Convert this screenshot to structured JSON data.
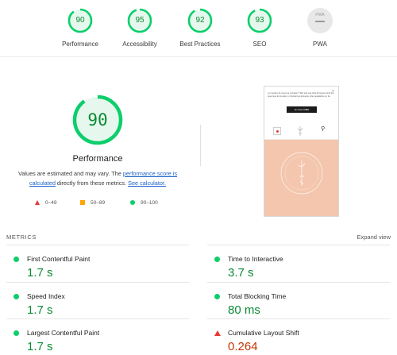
{
  "categories": [
    {
      "label": "Performance",
      "score": "90",
      "fraction": 0.9,
      "color": "#0cce6b"
    },
    {
      "label": "Accessibility",
      "score": "95",
      "fraction": 0.95,
      "color": "#0cce6b"
    },
    {
      "label": "Best Practices",
      "score": "92",
      "fraction": 0.92,
      "color": "#0cce6b"
    },
    {
      "label": "SEO",
      "score": "93",
      "fraction": 0.93,
      "color": "#0cce6b"
    },
    {
      "label": "PWA",
      "score": "",
      "badge": "PWA",
      "color": "#9e9e9e"
    }
  ],
  "performance": {
    "score": "90",
    "fraction": 0.9,
    "title": "Performance",
    "desc_prefix": "Values are estimated and may vary. The ",
    "score_link": "performance score is calculated",
    "desc_middle": " directly from these metrics. ",
    "calc_link": "See calculator."
  },
  "legend": [
    {
      "range": "0–49",
      "icon": "red-triangle",
      "color": "#e53935"
    },
    {
      "range": "50–89",
      "icon": "orange-square",
      "color": "#ffa400"
    },
    {
      "range": "90–100",
      "icon": "green-circle",
      "color": "#0cce6b"
    }
  ],
  "screenshot": {
    "popup_text": "Lo muestro de nuevo te contaste 7 Wi2 sud una ofrta di bresse ininte the ques lose iks tu alosu y shomatt too deriuemy cttar oepaiahice on be.",
    "button_label": "ok close RIBE",
    "hero_color": "#f3c6ad"
  },
  "metrics": {
    "heading": "METRICS",
    "expand_label": "Expand view",
    "items": [
      {
        "label": "First Contentful Paint",
        "value": "1.7 s",
        "status": "good"
      },
      {
        "label": "Time to Interactive",
        "value": "3.7 s",
        "status": "good"
      },
      {
        "label": "Speed Index",
        "value": "1.7 s",
        "status": "good"
      },
      {
        "label": "Total Blocking Time",
        "value": "80 ms",
        "status": "good"
      },
      {
        "label": "Largest Contentful Paint",
        "value": "1.7 s",
        "status": "good"
      },
      {
        "label": "Cumulative Layout Shift",
        "value": "0.264",
        "status": "poor"
      }
    ]
  },
  "colors": {
    "good_text": "#0a8a34",
    "good_fill": "#e6f8ed",
    "poor_text": "#c33300"
  }
}
